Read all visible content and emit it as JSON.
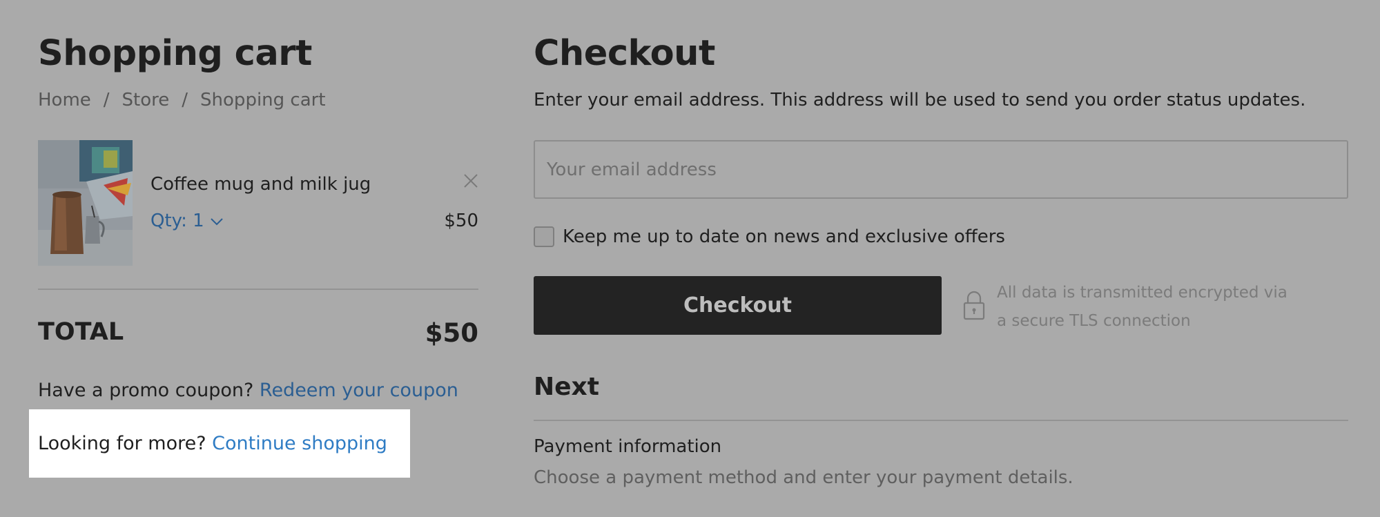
{
  "cart": {
    "title": "Shopping cart",
    "breadcrumb": [
      "Home",
      "/",
      "Store",
      "/",
      "Shopping cart"
    ],
    "item": {
      "name": "Coffee mug and milk jug",
      "qty_label": "Qty: 1",
      "price": "$50"
    },
    "total_label": "TOTAL",
    "total_value": "$50",
    "promo_text": "Have a promo coupon?",
    "promo_link": "Redeem your coupon",
    "more_text": "Looking for more?",
    "more_link": "Continue shopping"
  },
  "checkout": {
    "title": "Checkout",
    "email_description": "Enter your email address. This address will be used to send you order status updates.",
    "email_placeholder": "Your email address",
    "newsletter_label": "Keep me up to date on news and exclusive offers",
    "button_label": "Checkout",
    "secure_note_line1": "All data is transmitted encrypted via",
    "secure_note_line2": "a secure TLS connection",
    "next_title": "Next",
    "payment_title": "Payment information",
    "payment_description": "Choose a payment method and enter your payment details."
  },
  "icons": {
    "remove": "close-icon",
    "qty": "chevron-down-icon",
    "secure": "lock-icon"
  },
  "colors": {
    "overlay_background": "#aaaaaa",
    "link": "#2b5e92",
    "highlight_link": "#2f7cc4",
    "button_background": "#232323",
    "highlight_background": "#ffffff"
  }
}
